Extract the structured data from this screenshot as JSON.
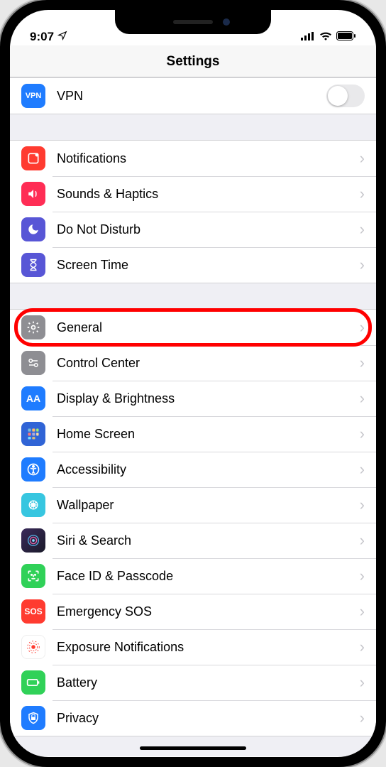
{
  "status": {
    "time": "9:07",
    "location_icon": "location-arrow"
  },
  "header": {
    "title": "Settings"
  },
  "group_vpn": {
    "items": [
      {
        "icon_bg": "#1f7cff",
        "icon": "VPN",
        "label": "VPN",
        "type": "toggle",
        "on": false
      }
    ]
  },
  "group_alerts": {
    "items": [
      {
        "icon_bg": "#ff3b30",
        "icon": "notifications",
        "label": "Notifications"
      },
      {
        "icon_bg": "#ff2d55",
        "icon": "sounds",
        "label": "Sounds & Haptics"
      },
      {
        "icon_bg": "#5856d6",
        "icon": "dnd",
        "label": "Do Not Disturb"
      },
      {
        "icon_bg": "#5856d6",
        "icon": "screentime",
        "label": "Screen Time"
      }
    ]
  },
  "group_general": {
    "items": [
      {
        "icon_bg": "#8e8e93",
        "icon": "gear",
        "label": "General",
        "highlighted": true
      },
      {
        "icon_bg": "#8e8e93",
        "icon": "control",
        "label": "Control Center"
      },
      {
        "icon_bg": "#1f7cff",
        "icon": "display",
        "label": "Display & Brightness"
      },
      {
        "icon_bg": "#3064d6",
        "icon": "homescreen",
        "label": "Home Screen"
      },
      {
        "icon_bg": "#1f7cff",
        "icon": "accessibility",
        "label": "Accessibility"
      },
      {
        "icon_bg": "#37c6e0",
        "icon": "wallpaper",
        "label": "Wallpaper"
      },
      {
        "icon_bg": "#222236",
        "icon": "siri",
        "label": "Siri & Search"
      },
      {
        "icon_bg": "#30d158",
        "icon": "faceid",
        "label": "Face ID & Passcode"
      },
      {
        "icon_bg": "#ff3b30",
        "icon": "sos",
        "label": "Emergency SOS"
      },
      {
        "icon_bg": "#ffffff",
        "icon": "exposure",
        "label": "Exposure Notifications"
      },
      {
        "icon_bg": "#30d158",
        "icon": "battery",
        "label": "Battery"
      },
      {
        "icon_bg": "#1f7cff",
        "icon": "privacy",
        "label": "Privacy"
      }
    ]
  }
}
